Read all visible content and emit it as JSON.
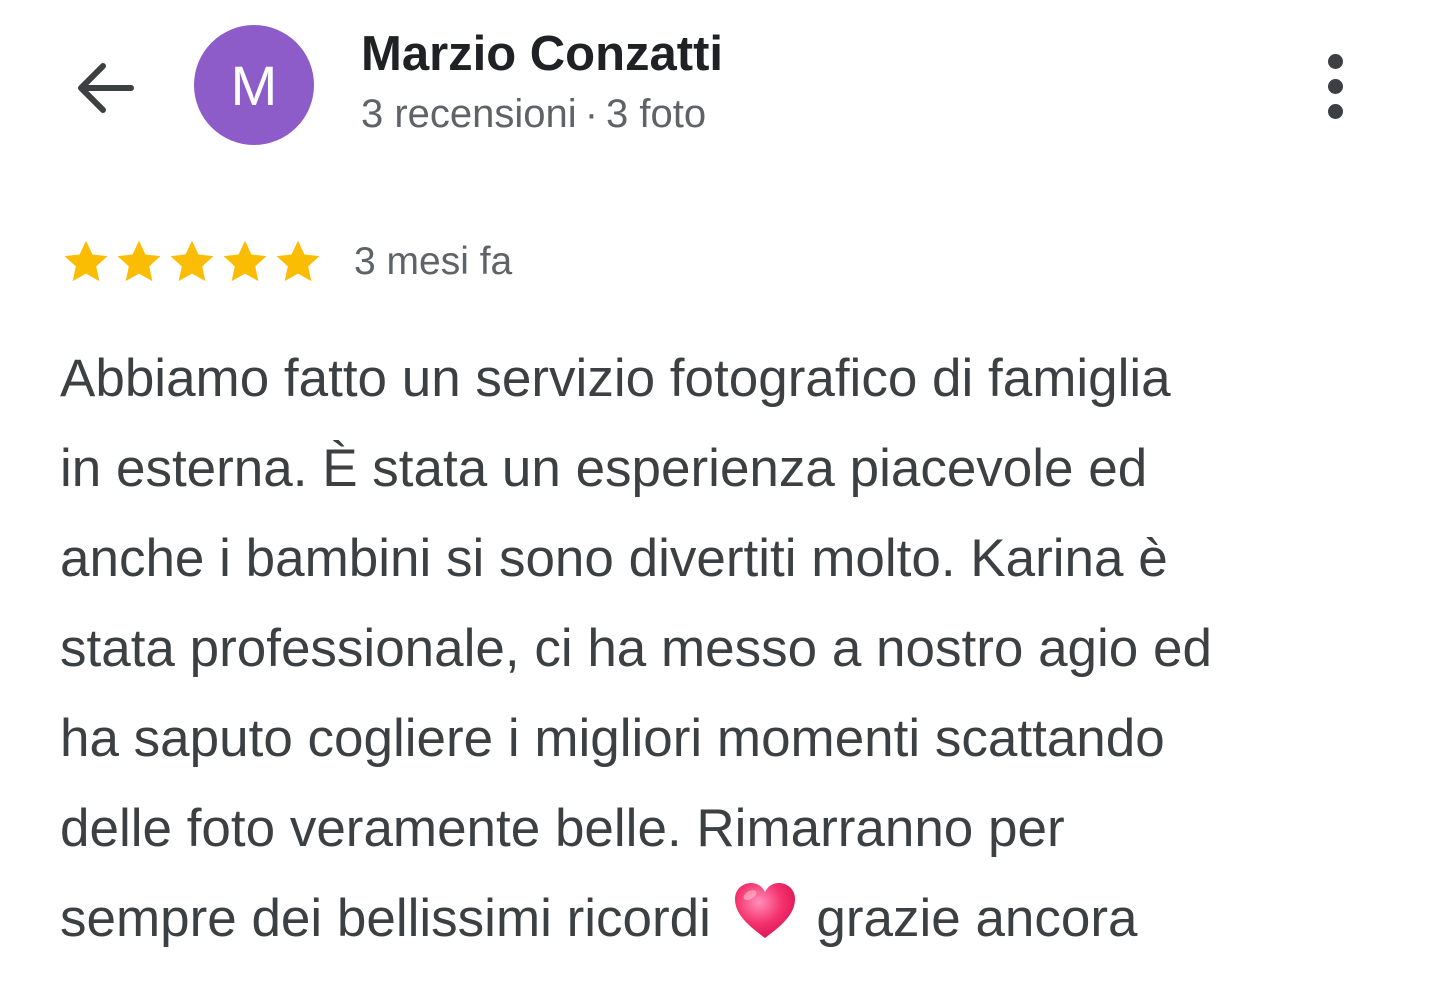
{
  "header": {
    "back_icon": "arrow-left-icon",
    "author": {
      "avatar_letter": "M",
      "avatar_color": "#8e5cc9",
      "name": "Marzio Conzatti",
      "reviews_count": "3 recensioni",
      "separator": "·",
      "photos_count": "3 foto"
    },
    "more_icon": "more-vert-icon"
  },
  "review": {
    "rating": 5,
    "rating_max": 5,
    "star_color": "#fbbc04",
    "date": "3 mesi fa",
    "text_lines": [
      "Abbiamo fatto un servizio fotografico di famiglia",
      "in esterna. È stata un esperienza piacevole ed",
      "anche i bambini si sono divertiti molto. Karina è",
      "stata professionale, ci ha messo a nostro agio ed",
      "ha saputo cogliere i migliori momenti scattando",
      "delle foto veramente belle. Rimarranno per"
    ],
    "last_line_before_emoji": "sempre dei bellissimi ricordi",
    "emoji": "heart-icon",
    "last_line_after_emoji": "grazie ancora"
  }
}
